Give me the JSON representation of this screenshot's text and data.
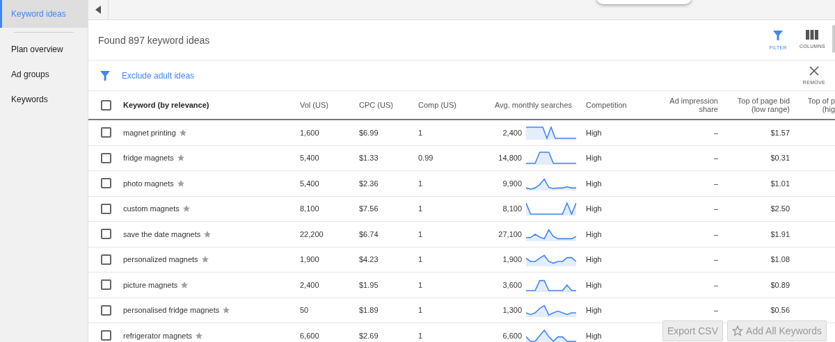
{
  "sidebar": {
    "items": [
      {
        "label": "Keyword ideas",
        "selected": true
      },
      {
        "label": "Plan overview",
        "selected": false
      },
      {
        "label": "Ad groups",
        "selected": false
      },
      {
        "label": "Keywords",
        "selected": false
      }
    ]
  },
  "summary": "Found 897 keyword ideas",
  "toolbar": [
    {
      "label": "FILTER",
      "kind": "filter",
      "active": true
    },
    {
      "label": "COLUMNS",
      "kind": "columns",
      "active": false
    }
  ],
  "filter_bar": {
    "chip": "Exclude adult ideas",
    "remove": "REMOVE"
  },
  "table": {
    "select_all": {
      "checked": false
    },
    "columns": [
      {
        "lines": [
          "Keyword (by relevance)"
        ]
      },
      {
        "lines": [
          "Vol (US)"
        ]
      },
      {
        "lines": [
          "CPC (US)"
        ]
      },
      {
        "lines": [
          "Comp (US)"
        ]
      },
      {
        "lines": [
          "Avg. monthly searches"
        ]
      },
      {
        "lines": [
          "Competition"
        ]
      },
      {
        "lines": [
          "Ad impression",
          "share"
        ]
      },
      {
        "lines": [
          "Top of page bid",
          "(low range)"
        ]
      },
      {
        "lines": [
          "Top of p",
          "(hig"
        ]
      }
    ],
    "rows": [
      {
        "keyword": "magnet printing",
        "checked": false,
        "vol": "1,600",
        "cpc": "$6.99",
        "comp": "1",
        "avg": "2,400",
        "competition": "High",
        "share": "–",
        "bid_low": "$1.57"
      },
      {
        "keyword": "fridge magnets",
        "checked": false,
        "vol": "5,400",
        "cpc": "$1.33",
        "comp": "0.99",
        "avg": "14,800",
        "competition": "High",
        "share": "–",
        "bid_low": "$0.31"
      },
      {
        "keyword": "photo magnets",
        "checked": false,
        "vol": "5,400",
        "cpc": "$2.36",
        "comp": "1",
        "avg": "9,900",
        "competition": "High",
        "share": "–",
        "bid_low": "$1.01"
      },
      {
        "keyword": "custom magnets",
        "checked": false,
        "vol": "8,100",
        "cpc": "$7.56",
        "comp": "1",
        "avg": "8,100",
        "competition": "High",
        "share": "–",
        "bid_low": "$2.50"
      },
      {
        "keyword": "save the date magnets",
        "checked": false,
        "vol": "22,200",
        "cpc": "$6.74",
        "comp": "1",
        "avg": "27,100",
        "competition": "High",
        "share": "–",
        "bid_low": "$1.91"
      },
      {
        "keyword": "personalized magnets",
        "checked": false,
        "vol": "1,900",
        "cpc": "$4.23",
        "comp": "1",
        "avg": "1,900",
        "competition": "High",
        "share": "–",
        "bid_low": "$1.08"
      },
      {
        "keyword": "picture magnets",
        "checked": false,
        "vol": "2,400",
        "cpc": "$1.95",
        "comp": "1",
        "avg": "3,600",
        "competition": "High",
        "share": "–",
        "bid_low": "$0.89"
      },
      {
        "keyword": "personalised fridge magnets",
        "checked": false,
        "vol": "50",
        "cpc": "$1.89",
        "comp": "1",
        "avg": "1,300",
        "competition": "High",
        "share": "–",
        "bid_low": "$0.56"
      },
      {
        "keyword": "refrigerator magnets",
        "checked": false,
        "vol": "6,600",
        "cpc": "$2.69",
        "comp": "1",
        "avg": "6,600",
        "competition": "High"
      }
    ]
  },
  "actions": [
    {
      "label": "Export CSV",
      "kind": "plain"
    },
    {
      "label": "Add All Keywords",
      "kind": "star"
    }
  ]
}
